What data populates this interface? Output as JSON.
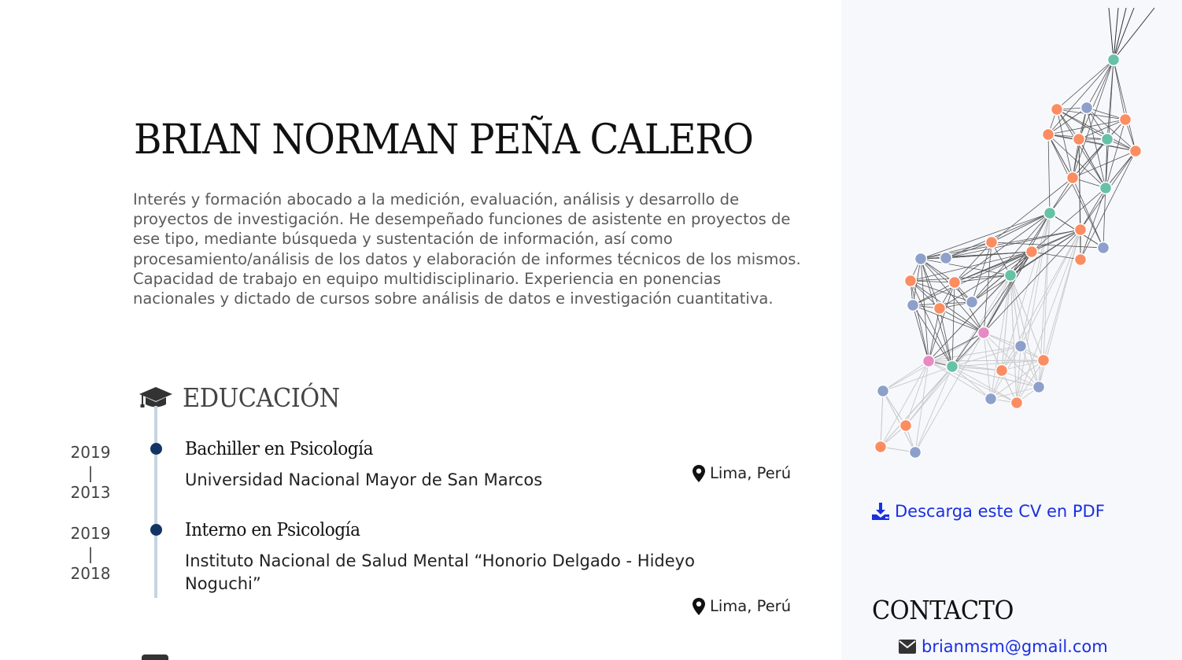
{
  "header": {
    "name": "BRIAN NORMAN PEÑA CALERO",
    "summary": "Interés y formación abocado a la medición, evaluación, análisis y desarrollo de proyectos de investigación. He desempeñado funciones de asistente en proyectos de ese tipo, mediante búsqueda y sustentación de información, así como procesamiento/análisis de los datos y elaboración de informes técnicos de los mismos. Capacidad de trabajo en equipo multidisciplinario. Experiencia en ponencias nacionales y dictado de cursos sobre análisis de datos e investigación cuantitativa."
  },
  "education": {
    "title": "EDUCACIÓN",
    "icon": "graduation-cap-icon",
    "entries": [
      {
        "year_end": "2019",
        "separator": "|",
        "year_start": "2013",
        "degree": "Bachiller en Psicología",
        "institution": "Universidad Nacional Mayor de San Marcos",
        "location": "Lima, Perú"
      },
      {
        "year_end": "2019",
        "separator": "|",
        "year_start": "2018",
        "degree": "Interno en Psicología",
        "institution": "Instituto Nacional de Salud Mental “Honorio Delgado - Hideyo Noguchi”",
        "location": "Lima, Perú"
      }
    ]
  },
  "sidebar": {
    "download_label": "Descarga este CV en PDF",
    "contact_title": "CONTACTO",
    "email": "brianmsm@gmail.com"
  },
  "colors": {
    "accent_link": "#1a2fe0",
    "timeline_dot": "#113463",
    "timeline_line": "#c5d4e3",
    "sidebar_bg": "#f7f8fc",
    "node_orange": "#fc8d62",
    "node_blue": "#8da0cb",
    "node_green": "#66c2a5",
    "node_pink": "#e78ac3"
  }
}
